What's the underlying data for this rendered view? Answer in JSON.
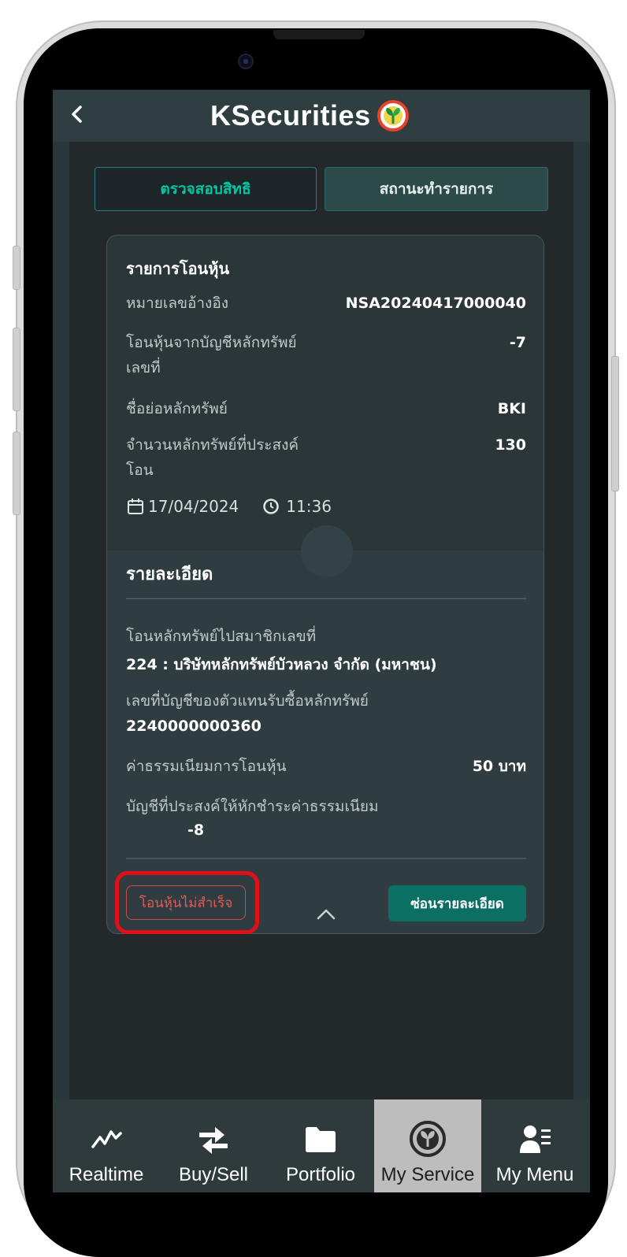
{
  "header": {
    "logo_text": "KSecurities"
  },
  "tabs": [
    {
      "label": "ตรวจสอบสิทธิ"
    },
    {
      "label": "สถานะทำรายการ"
    }
  ],
  "card": {
    "title": "รายการโอนหุ้น",
    "rows": [
      {
        "label": "หมายเลขอ้างอิง",
        "value": "NSA20240417000040"
      },
      {
        "label": "โอนหุ้นจากบัญชีหลักทรัพย์เลขที่",
        "label_line1": "โอนหุ้นจากบัญชีหลักทรัพย์",
        "label_line2": "เลขที่",
        "value": "-7"
      },
      {
        "label": "ชื่อย่อหลักทรัพย์",
        "value": "BKI"
      },
      {
        "label_line1": "จำนวนหลักทรัพย์ที่ประสงค์",
        "label_line2": "โอน",
        "value": "130"
      }
    ],
    "date": "17/04/2024",
    "time": "11:36"
  },
  "details": {
    "title": "รายละเอียด",
    "member_label": "โอนหลักทรัพย์ไปสมาชิกเลขที่",
    "member_value": "224 : บริษัทหลักทรัพย์บัวหลวง จำกัด (มหาชน)",
    "agent_account_label": "เลขที่บัญชีของตัวแทนรับซื้อหลักทรัพย์",
    "agent_account_value": "2240000000360",
    "fee_label": "ค่าธรรมเนียมการโอนหุ้น",
    "fee_value": "50 บาท",
    "fee_account_label": "บัญชีที่ประสงค์ให้หักชำระค่าธรรมเนียม",
    "fee_account_value": "-8"
  },
  "status_badge": "โอนหุ้นไม่สำเร็จ",
  "hide_button": "ซ่อนรายละเอียด",
  "colors": {
    "accent_teal": "#00c6a4",
    "button_green": "#0c6f64",
    "error_red": "#e35a5a",
    "highlight_red": "#e0101a"
  },
  "bottom_nav": [
    {
      "label": "Realtime",
      "icon": "realtime-chart-icon"
    },
    {
      "label": "Buy/Sell",
      "icon": "buy-sell-arrows-icon"
    },
    {
      "label": "Portfolio",
      "icon": "folder-icon"
    },
    {
      "label": "My Service",
      "icon": "kbank-leaf-icon",
      "active": true
    },
    {
      "label": "My Menu",
      "icon": "user-menu-icon"
    }
  ]
}
